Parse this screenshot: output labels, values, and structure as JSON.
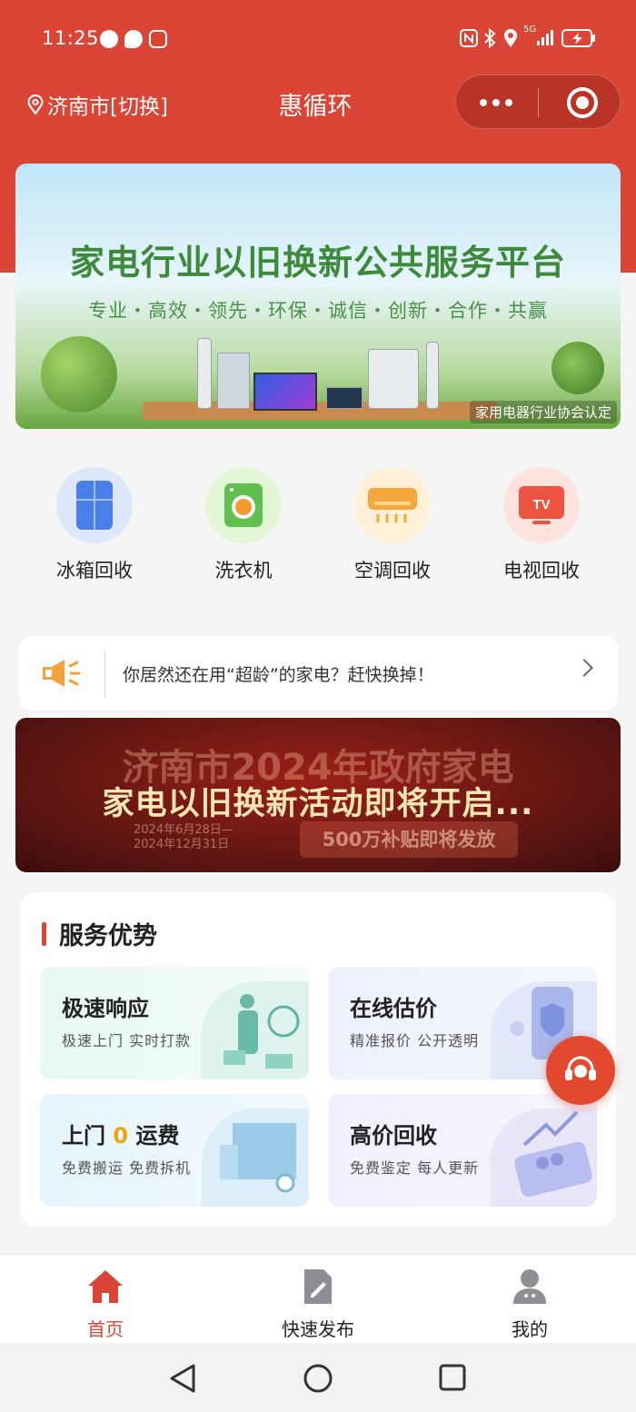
{
  "status_bar": {
    "time": "11:25",
    "network": "5G"
  },
  "nav": {
    "city": "济南市[切换]",
    "title": "惠循环"
  },
  "hero": {
    "title": "家电行业以旧换新公共服务平台",
    "subtitle": "专业・高效・领先・环保・诚信・创新・合作・共赢",
    "certified": "家用电器行业协会认定"
  },
  "categories": [
    {
      "label": "冰箱回收",
      "icon": "fridge-icon",
      "color": "#dfe8fb"
    },
    {
      "label": "洗衣机",
      "icon": "washer-icon",
      "color": "#e2f7d6"
    },
    {
      "label": "空调回收",
      "icon": "air-conditioner-icon",
      "color": "#fff0d8"
    },
    {
      "label": "电视回收",
      "icon": "tv-icon",
      "color": "#fde2de"
    }
  ],
  "notice": {
    "text": "你居然还在用“超龄”的家电？赶快换掉！"
  },
  "promo": {
    "line1": "济南市2024年政府家电",
    "line2": "家电以旧换新活动即将开启...",
    "date_start": "2024年6月28日—",
    "date_end": "2024年12月31日",
    "subsidy": "500万补贴即将发放"
  },
  "services": {
    "title": "服务优势",
    "tiles": [
      {
        "title": "极速响应",
        "desc": "极速上门  实时打款"
      },
      {
        "title": "在线估价",
        "desc": "精准报价  公开透明"
      },
      {
        "title_pre": "上门 ",
        "title_hl": "0",
        "title_post": " 运费",
        "desc": "免费搬运  免费拆机"
      },
      {
        "title": "高价回收",
        "desc": "免费鉴定  每人更新"
      }
    ]
  },
  "tabbar": [
    {
      "label": "首页",
      "icon": "home-icon"
    },
    {
      "label": "快速发布",
      "icon": "edit-doc-icon"
    },
    {
      "label": "我的",
      "icon": "user-icon"
    }
  ],
  "colors": {
    "brand": "#db4535",
    "highlight": "#f0a21a"
  }
}
